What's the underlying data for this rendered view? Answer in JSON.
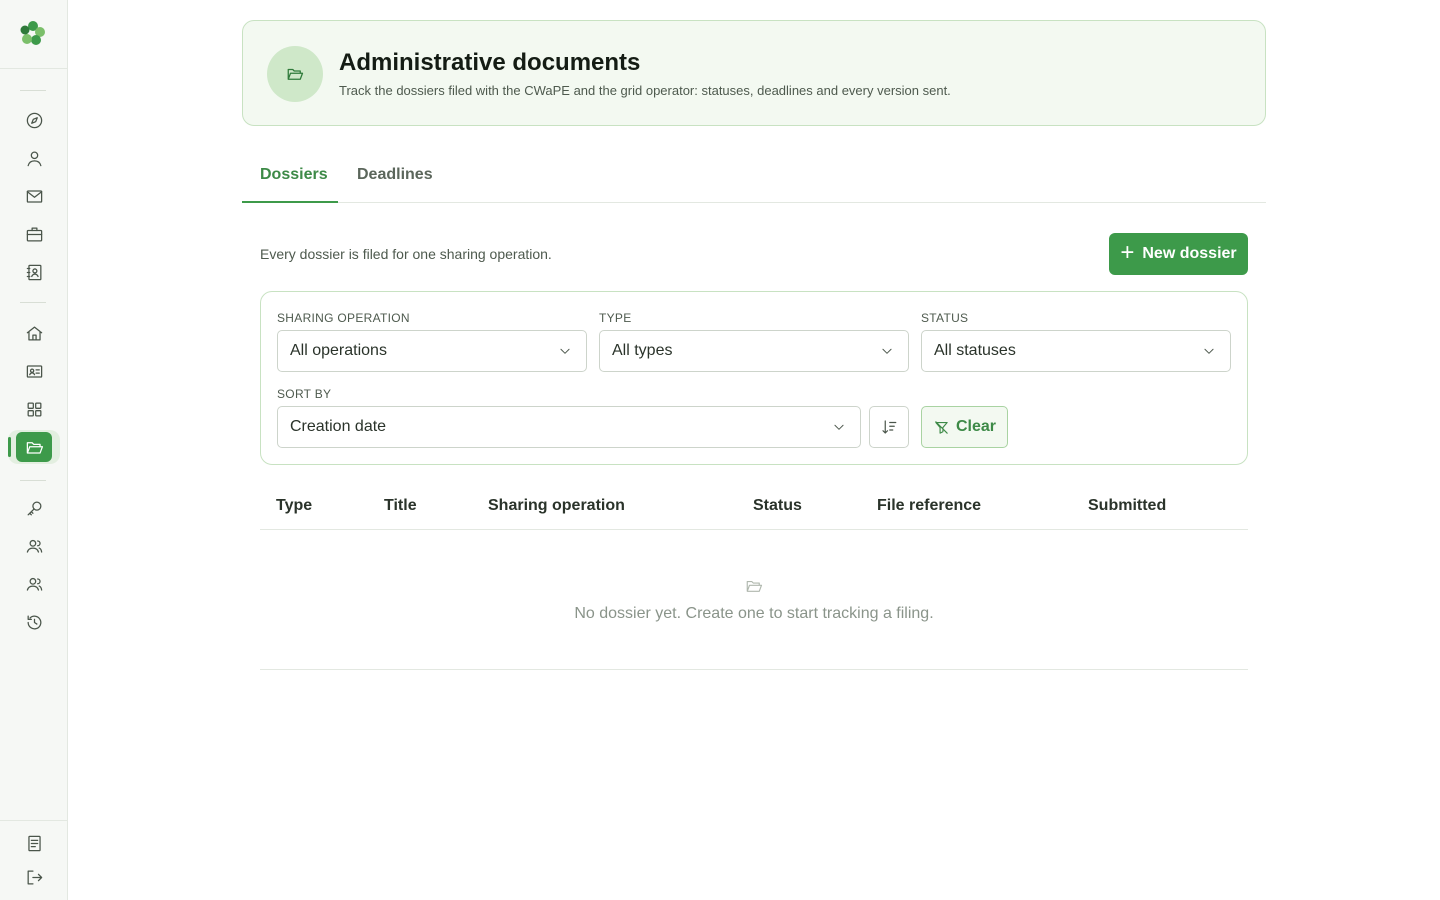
{
  "header": {
    "title": "Administrative documents",
    "subtitle": "Track the dossiers filed with the CWaPE and the grid operator: statuses, deadlines and every version sent."
  },
  "tabs": [
    {
      "label": "Dossiers",
      "active": true
    },
    {
      "label": "Deadlines",
      "active": false
    }
  ],
  "intro": "Every dossier is filed for one sharing operation.",
  "new_button": {
    "label": "New dossier"
  },
  "filters": {
    "operation": {
      "label": "SHARING OPERATION",
      "value": "All operations"
    },
    "type": {
      "label": "TYPE",
      "value": "All types"
    },
    "status": {
      "label": "STATUS",
      "value": "All statuses"
    },
    "sort": {
      "label": "SORT BY",
      "value": "Creation date"
    },
    "clear_label": "Clear"
  },
  "table": {
    "columns": [
      "Type",
      "Title",
      "Sharing operation",
      "Status",
      "File reference",
      "Submitted"
    ],
    "empty_message": "No dossier yet. Create one to start tracking a filing."
  },
  "sidebar": {
    "active_item": "documents",
    "icons": [
      "compass-icon",
      "user-icon",
      "mail-icon",
      "briefcase-icon",
      "contacts-icon",
      "home-icon",
      "id-card-icon",
      "grid-icon",
      "folder-open-icon",
      "key-icon",
      "users-icon",
      "team-icon",
      "history-icon",
      "document-icon",
      "logout-icon"
    ]
  },
  "colors": {
    "accent": "#3d9a4a",
    "accent_light": "#f3f9f1",
    "border_green": "#c8e2c2"
  }
}
